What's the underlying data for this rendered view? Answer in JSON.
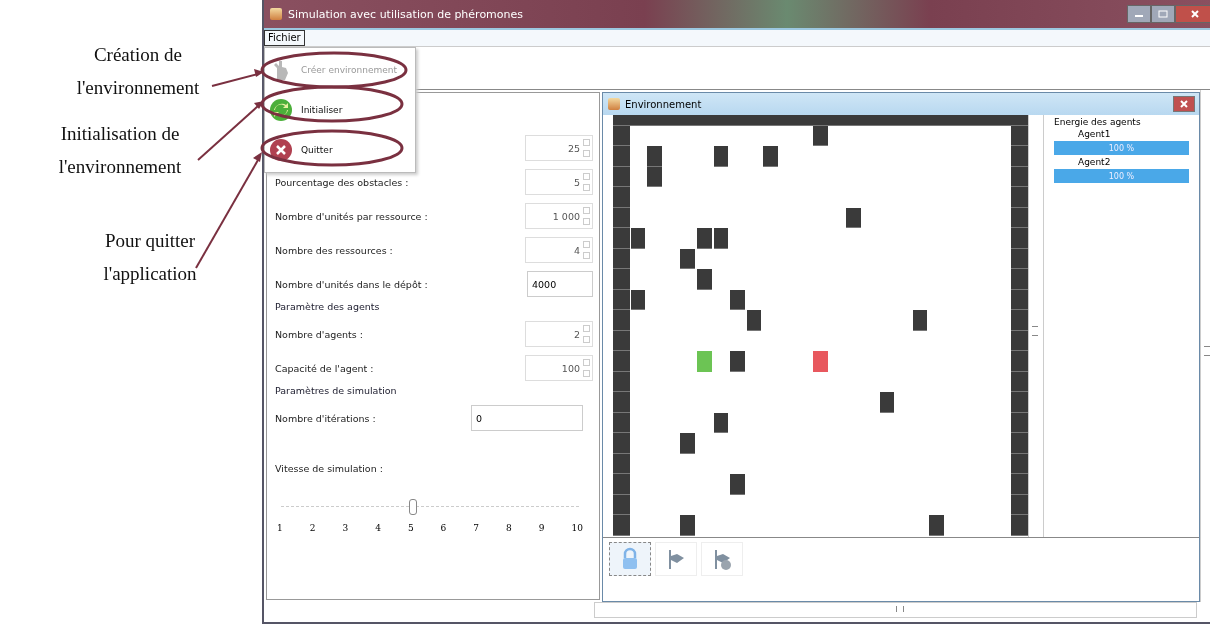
{
  "annotations": [
    {
      "text": "Création de l'environnement"
    },
    {
      "text": "Initialisation de l'environnement"
    },
    {
      "text": "Pour quitter l'application"
    }
  ],
  "window": {
    "title": "Simulation avec utilisation de phéromones"
  },
  "menu_bar": [
    {
      "label": "Fichier",
      "selected": true
    }
  ],
  "menu": {
    "items": [
      {
        "kind": "create",
        "label": "Créer environnement",
        "disabled": true
      },
      {
        "kind": "init",
        "label": "Initialiser",
        "disabled": false
      },
      {
        "kind": "quit",
        "label": "Quitter",
        "disabled": false
      }
    ]
  },
  "form": [
    {
      "kind": "spinner",
      "value": "25"
    },
    {
      "kind": "spinner",
      "label": "Pourcentage des obstacles :",
      "value": "5"
    },
    {
      "kind": "spinner",
      "label": "Nombre d'unités par ressource :",
      "value": "1 000"
    },
    {
      "kind": "spinner",
      "label": "Nombre des ressources :",
      "value": "4"
    },
    {
      "kind": "text",
      "label": "Nombre d'unités dans le dépôt :",
      "value": "4000",
      "wide": false
    },
    {
      "kind": "section",
      "label": "Paramètre des agents"
    },
    {
      "kind": "spinner",
      "label": "Nombre d'agents :",
      "value": "2"
    },
    {
      "kind": "spinner",
      "label": "Capacité de l'agent :",
      "value": "100"
    },
    {
      "kind": "section",
      "label": "Paramètres de simulation"
    },
    {
      "kind": "text",
      "label": "Nombre d'itérations :",
      "value": "0",
      "wide": true
    },
    {
      "kind": "label",
      "label": "Vitesse de simulation :"
    },
    {
      "kind": "slider",
      "level": 0.444,
      "ticks": [
        "1",
        "2",
        "3",
        "4",
        "5",
        "6",
        "7",
        "8",
        "9",
        "10"
      ]
    }
  ],
  "environment": {
    "title": "Environnement",
    "grid": [
      [
        {
          "kind": "wall"
        },
        {
          "kind": "wall"
        },
        {
          "kind": "wall"
        },
        {
          "kind": "wall"
        },
        {
          "kind": "wall"
        },
        {
          "kind": "wall"
        },
        {
          "kind": "wall"
        },
        {
          "kind": "wall"
        },
        {
          "kind": "wall"
        },
        {
          "kind": "wall"
        },
        {
          "kind": "wall"
        },
        {
          "kind": "wall"
        },
        {
          "kind": "wall"
        },
        {
          "kind": "wall"
        },
        {
          "kind": "wall"
        },
        {
          "kind": "wall"
        },
        {
          "kind": "wall"
        },
        {
          "kind": "wall"
        },
        {
          "kind": "wall"
        },
        {
          "kind": "wall"
        },
        {
          "kind": "wall"
        },
        {
          "kind": "wall"
        },
        {
          "kind": "wall"
        },
        {
          "kind": "wall"
        },
        {
          "kind": "wall"
        }
      ],
      [
        {
          "kind": "wall"
        },
        {
          "kind": "empty"
        },
        {
          "kind": "empty"
        },
        {
          "kind": "empty"
        },
        {
          "kind": "empty"
        },
        {
          "kind": "empty"
        },
        {
          "kind": "empty"
        },
        {
          "kind": "empty"
        },
        {
          "kind": "empty"
        },
        {
          "kind": "empty"
        },
        {
          "kind": "empty"
        },
        {
          "kind": "empty"
        },
        {
          "kind": "obstacle"
        },
        {
          "kind": "empty"
        },
        {
          "kind": "empty"
        },
        {
          "kind": "empty"
        },
        {
          "kind": "empty"
        },
        {
          "kind": "empty"
        },
        {
          "kind": "empty"
        },
        {
          "kind": "empty"
        },
        {
          "kind": "empty"
        },
        {
          "kind": "empty"
        },
        {
          "kind": "empty"
        },
        {
          "kind": "empty"
        },
        {
          "kind": "wall"
        }
      ],
      [
        {
          "kind": "wall"
        },
        {
          "kind": "empty"
        },
        {
          "kind": "obstacle"
        },
        {
          "kind": "empty"
        },
        {
          "kind": "empty"
        },
        {
          "kind": "empty"
        },
        {
          "kind": "obstacle"
        },
        {
          "kind": "empty"
        },
        {
          "kind": "empty"
        },
        {
          "kind": "obstacle"
        },
        {
          "kind": "empty"
        },
        {
          "kind": "empty"
        },
        {
          "kind": "empty"
        },
        {
          "kind": "empty"
        },
        {
          "kind": "empty"
        },
        {
          "kind": "empty"
        },
        {
          "kind": "empty"
        },
        {
          "kind": "empty"
        },
        {
          "kind": "empty"
        },
        {
          "kind": "empty"
        },
        {
          "kind": "empty"
        },
        {
          "kind": "empty"
        },
        {
          "kind": "empty"
        },
        {
          "kind": "empty"
        },
        {
          "kind": "wall"
        }
      ],
      [
        {
          "kind": "wall"
        },
        {
          "kind": "empty"
        },
        {
          "kind": "obstacle"
        },
        {
          "kind": "empty"
        },
        {
          "kind": "empty"
        },
        {
          "kind": "empty"
        },
        {
          "kind": "empty"
        },
        {
          "kind": "empty"
        },
        {
          "kind": "empty"
        },
        {
          "kind": "empty"
        },
        {
          "kind": "empty"
        },
        {
          "kind": "empty"
        },
        {
          "kind": "empty"
        },
        {
          "kind": "empty"
        },
        {
          "kind": "empty"
        },
        {
          "kind": "empty"
        },
        {
          "kind": "empty"
        },
        {
          "kind": "empty"
        },
        {
          "kind": "empty"
        },
        {
          "kind": "empty"
        },
        {
          "kind": "empty"
        },
        {
          "kind": "empty"
        },
        {
          "kind": "empty"
        },
        {
          "kind": "empty"
        },
        {
          "kind": "wall"
        }
      ],
      [
        {
          "kind": "wall"
        },
        {
          "kind": "empty"
        },
        {
          "kind": "empty"
        },
        {
          "kind": "empty"
        },
        {
          "kind": "empty"
        },
        {
          "kind": "empty"
        },
        {
          "kind": "empty"
        },
        {
          "kind": "empty"
        },
        {
          "kind": "empty"
        },
        {
          "kind": "empty"
        },
        {
          "kind": "empty"
        },
        {
          "kind": "empty"
        },
        {
          "kind": "empty"
        },
        {
          "kind": "empty"
        },
        {
          "kind": "empty"
        },
        {
          "kind": "empty"
        },
        {
          "kind": "empty"
        },
        {
          "kind": "empty"
        },
        {
          "kind": "empty"
        },
        {
          "kind": "empty"
        },
        {
          "kind": "empty"
        },
        {
          "kind": "empty"
        },
        {
          "kind": "empty"
        },
        {
          "kind": "empty"
        },
        {
          "kind": "wall"
        }
      ],
      [
        {
          "kind": "wall"
        },
        {
          "kind": "empty"
        },
        {
          "kind": "empty"
        },
        {
          "kind": "empty"
        },
        {
          "kind": "empty"
        },
        {
          "kind": "empty"
        },
        {
          "kind": "empty"
        },
        {
          "kind": "empty"
        },
        {
          "kind": "empty"
        },
        {
          "kind": "empty"
        },
        {
          "kind": "empty"
        },
        {
          "kind": "empty"
        },
        {
          "kind": "empty"
        },
        {
          "kind": "empty"
        },
        {
          "kind": "obstacle"
        },
        {
          "kind": "empty"
        },
        {
          "kind": "empty"
        },
        {
          "kind": "empty"
        },
        {
          "kind": "empty"
        },
        {
          "kind": "empty"
        },
        {
          "kind": "empty"
        },
        {
          "kind": "empty"
        },
        {
          "kind": "empty"
        },
        {
          "kind": "empty"
        },
        {
          "kind": "wall"
        }
      ],
      [
        {
          "kind": "wall"
        },
        {
          "kind": "obstacle"
        },
        {
          "kind": "empty"
        },
        {
          "kind": "empty"
        },
        {
          "kind": "empty"
        },
        {
          "kind": "obstacle"
        },
        {
          "kind": "obstacle"
        },
        {
          "kind": "empty"
        },
        {
          "kind": "empty"
        },
        {
          "kind": "empty"
        },
        {
          "kind": "empty"
        },
        {
          "kind": "empty"
        },
        {
          "kind": "empty"
        },
        {
          "kind": "empty"
        },
        {
          "kind": "empty"
        },
        {
          "kind": "empty"
        },
        {
          "kind": "empty"
        },
        {
          "kind": "empty"
        },
        {
          "kind": "empty"
        },
        {
          "kind": "empty"
        },
        {
          "kind": "empty"
        },
        {
          "kind": "empty"
        },
        {
          "kind": "empty"
        },
        {
          "kind": "empty"
        },
        {
          "kind": "wall"
        }
      ],
      [
        {
          "kind": "wall"
        },
        {
          "kind": "empty"
        },
        {
          "kind": "empty"
        },
        {
          "kind": "empty"
        },
        {
          "kind": "obstacle"
        },
        {
          "kind": "empty"
        },
        {
          "kind": "empty"
        },
        {
          "kind": "empty"
        },
        {
          "kind": "empty"
        },
        {
          "kind": "empty"
        },
        {
          "kind": "empty"
        },
        {
          "kind": "empty"
        },
        {
          "kind": "empty"
        },
        {
          "kind": "empty"
        },
        {
          "kind": "empty"
        },
        {
          "kind": "empty"
        },
        {
          "kind": "empty"
        },
        {
          "kind": "empty"
        },
        {
          "kind": "empty"
        },
        {
          "kind": "empty"
        },
        {
          "kind": "empty"
        },
        {
          "kind": "empty"
        },
        {
          "kind": "empty"
        },
        {
          "kind": "empty"
        },
        {
          "kind": "wall"
        }
      ],
      [
        {
          "kind": "wall"
        },
        {
          "kind": "empty"
        },
        {
          "kind": "empty"
        },
        {
          "kind": "empty"
        },
        {
          "kind": "empty"
        },
        {
          "kind": "obstacle"
        },
        {
          "kind": "empty"
        },
        {
          "kind": "empty"
        },
        {
          "kind": "empty"
        },
        {
          "kind": "empty"
        },
        {
          "kind": "empty"
        },
        {
          "kind": "empty"
        },
        {
          "kind": "empty"
        },
        {
          "kind": "empty"
        },
        {
          "kind": "empty"
        },
        {
          "kind": "empty"
        },
        {
          "kind": "empty"
        },
        {
          "kind": "empty"
        },
        {
          "kind": "empty"
        },
        {
          "kind": "empty"
        },
        {
          "kind": "empty"
        },
        {
          "kind": "empty"
        },
        {
          "kind": "empty"
        },
        {
          "kind": "empty"
        },
        {
          "kind": "wall"
        }
      ],
      [
        {
          "kind": "wall"
        },
        {
          "kind": "obstacle"
        },
        {
          "kind": "empty"
        },
        {
          "kind": "empty"
        },
        {
          "kind": "empty"
        },
        {
          "kind": "empty"
        },
        {
          "kind": "empty"
        },
        {
          "kind": "obstacle"
        },
        {
          "kind": "empty"
        },
        {
          "kind": "empty"
        },
        {
          "kind": "empty"
        },
        {
          "kind": "empty"
        },
        {
          "kind": "empty"
        },
        {
          "kind": "empty"
        },
        {
          "kind": "empty"
        },
        {
          "kind": "empty"
        },
        {
          "kind": "empty"
        },
        {
          "kind": "empty"
        },
        {
          "kind": "empty"
        },
        {
          "kind": "empty"
        },
        {
          "kind": "empty"
        },
        {
          "kind": "empty"
        },
        {
          "kind": "empty"
        },
        {
          "kind": "empty"
        },
        {
          "kind": "wall"
        }
      ],
      [
        {
          "kind": "wall"
        },
        {
          "kind": "empty"
        },
        {
          "kind": "empty"
        },
        {
          "kind": "empty"
        },
        {
          "kind": "empty"
        },
        {
          "kind": "empty"
        },
        {
          "kind": "empty"
        },
        {
          "kind": "empty"
        },
        {
          "kind": "obstacle"
        },
        {
          "kind": "empty"
        },
        {
          "kind": "empty"
        },
        {
          "kind": "empty"
        },
        {
          "kind": "empty"
        },
        {
          "kind": "empty"
        },
        {
          "kind": "empty"
        },
        {
          "kind": "empty"
        },
        {
          "kind": "empty"
        },
        {
          "kind": "empty"
        },
        {
          "kind": "obstacle"
        },
        {
          "kind": "empty"
        },
        {
          "kind": "empty"
        },
        {
          "kind": "empty"
        },
        {
          "kind": "empty"
        },
        {
          "kind": "empty"
        },
        {
          "kind": "wall"
        }
      ],
      [
        {
          "kind": "wall"
        },
        {
          "kind": "empty"
        },
        {
          "kind": "empty"
        },
        {
          "kind": "empty"
        },
        {
          "kind": "empty"
        },
        {
          "kind": "empty"
        },
        {
          "kind": "empty"
        },
        {
          "kind": "empty"
        },
        {
          "kind": "empty"
        },
        {
          "kind": "empty"
        },
        {
          "kind": "empty"
        },
        {
          "kind": "empty"
        },
        {
          "kind": "empty"
        },
        {
          "kind": "empty"
        },
        {
          "kind": "empty"
        },
        {
          "kind": "empty"
        },
        {
          "kind": "empty"
        },
        {
          "kind": "empty"
        },
        {
          "kind": "empty"
        },
        {
          "kind": "empty"
        },
        {
          "kind": "empty"
        },
        {
          "kind": "empty"
        },
        {
          "kind": "empty"
        },
        {
          "kind": "empty"
        },
        {
          "kind": "wall"
        }
      ],
      [
        {
          "kind": "wall"
        },
        {
          "kind": "empty"
        },
        {
          "kind": "empty"
        },
        {
          "kind": "empty"
        },
        {
          "kind": "empty"
        },
        {
          "kind": "agent",
          "color": "#6cc454"
        },
        {
          "kind": "empty"
        },
        {
          "kind": "obstacle"
        },
        {
          "kind": "empty"
        },
        {
          "kind": "empty"
        },
        {
          "kind": "empty"
        },
        {
          "kind": "empty"
        },
        {
          "kind": "agent",
          "color": "#e8585e"
        },
        {
          "kind": "empty"
        },
        {
          "kind": "empty"
        },
        {
          "kind": "empty"
        },
        {
          "kind": "empty"
        },
        {
          "kind": "empty"
        },
        {
          "kind": "empty"
        },
        {
          "kind": "empty"
        },
        {
          "kind": "empty"
        },
        {
          "kind": "empty"
        },
        {
          "kind": "empty"
        },
        {
          "kind": "empty"
        },
        {
          "kind": "wall"
        }
      ],
      [
        {
          "kind": "wall"
        },
        {
          "kind": "empty"
        },
        {
          "kind": "empty"
        },
        {
          "kind": "empty"
        },
        {
          "kind": "empty"
        },
        {
          "kind": "empty"
        },
        {
          "kind": "empty"
        },
        {
          "kind": "empty"
        },
        {
          "kind": "empty"
        },
        {
          "kind": "empty"
        },
        {
          "kind": "empty"
        },
        {
          "kind": "empty"
        },
        {
          "kind": "empty"
        },
        {
          "kind": "empty"
        },
        {
          "kind": "empty"
        },
        {
          "kind": "empty"
        },
        {
          "kind": "empty"
        },
        {
          "kind": "empty"
        },
        {
          "kind": "empty"
        },
        {
          "kind": "empty"
        },
        {
          "kind": "empty"
        },
        {
          "kind": "empty"
        },
        {
          "kind": "empty"
        },
        {
          "kind": "empty"
        },
        {
          "kind": "wall"
        }
      ],
      [
        {
          "kind": "wall"
        },
        {
          "kind": "empty"
        },
        {
          "kind": "empty"
        },
        {
          "kind": "empty"
        },
        {
          "kind": "empty"
        },
        {
          "kind": "empty"
        },
        {
          "kind": "empty"
        },
        {
          "kind": "empty"
        },
        {
          "kind": "empty"
        },
        {
          "kind": "empty"
        },
        {
          "kind": "empty"
        },
        {
          "kind": "empty"
        },
        {
          "kind": "empty"
        },
        {
          "kind": "empty"
        },
        {
          "kind": "empty"
        },
        {
          "kind": "empty"
        },
        {
          "kind": "obstacle"
        },
        {
          "kind": "empty"
        },
        {
          "kind": "empty"
        },
        {
          "kind": "empty"
        },
        {
          "kind": "empty"
        },
        {
          "kind": "empty"
        },
        {
          "kind": "empty"
        },
        {
          "kind": "empty"
        },
        {
          "kind": "wall"
        }
      ],
      [
        {
          "kind": "wall"
        },
        {
          "kind": "empty"
        },
        {
          "kind": "empty"
        },
        {
          "kind": "empty"
        },
        {
          "kind": "empty"
        },
        {
          "kind": "empty"
        },
        {
          "kind": "obstacle"
        },
        {
          "kind": "empty"
        },
        {
          "kind": "empty"
        },
        {
          "kind": "empty"
        },
        {
          "kind": "empty"
        },
        {
          "kind": "empty"
        },
        {
          "kind": "empty"
        },
        {
          "kind": "empty"
        },
        {
          "kind": "empty"
        },
        {
          "kind": "empty"
        },
        {
          "kind": "empty"
        },
        {
          "kind": "empty"
        },
        {
          "kind": "empty"
        },
        {
          "kind": "empty"
        },
        {
          "kind": "empty"
        },
        {
          "kind": "empty"
        },
        {
          "kind": "empty"
        },
        {
          "kind": "empty"
        },
        {
          "kind": "wall"
        }
      ],
      [
        {
          "kind": "wall"
        },
        {
          "kind": "empty"
        },
        {
          "kind": "empty"
        },
        {
          "kind": "empty"
        },
        {
          "kind": "obstacle"
        },
        {
          "kind": "empty"
        },
        {
          "kind": "empty"
        },
        {
          "kind": "empty"
        },
        {
          "kind": "empty"
        },
        {
          "kind": "empty"
        },
        {
          "kind": "empty"
        },
        {
          "kind": "empty"
        },
        {
          "kind": "empty"
        },
        {
          "kind": "empty"
        },
        {
          "kind": "empty"
        },
        {
          "kind": "empty"
        },
        {
          "kind": "empty"
        },
        {
          "kind": "empty"
        },
        {
          "kind": "empty"
        },
        {
          "kind": "empty"
        },
        {
          "kind": "empty"
        },
        {
          "kind": "empty"
        },
        {
          "kind": "empty"
        },
        {
          "kind": "empty"
        },
        {
          "kind": "wall"
        }
      ],
      [
        {
          "kind": "wall"
        },
        {
          "kind": "empty"
        },
        {
          "kind": "empty"
        },
        {
          "kind": "empty"
        },
        {
          "kind": "empty"
        },
        {
          "kind": "empty"
        },
        {
          "kind": "empty"
        },
        {
          "kind": "empty"
        },
        {
          "kind": "empty"
        },
        {
          "kind": "empty"
        },
        {
          "kind": "empty"
        },
        {
          "kind": "empty"
        },
        {
          "kind": "empty"
        },
        {
          "kind": "empty"
        },
        {
          "kind": "empty"
        },
        {
          "kind": "empty"
        },
        {
          "kind": "empty"
        },
        {
          "kind": "empty"
        },
        {
          "kind": "empty"
        },
        {
          "kind": "empty"
        },
        {
          "kind": "empty"
        },
        {
          "kind": "empty"
        },
        {
          "kind": "empty"
        },
        {
          "kind": "empty"
        },
        {
          "kind": "wall"
        }
      ],
      [
        {
          "kind": "wall"
        },
        {
          "kind": "empty"
        },
        {
          "kind": "empty"
        },
        {
          "kind": "empty"
        },
        {
          "kind": "empty"
        },
        {
          "kind": "empty"
        },
        {
          "kind": "empty"
        },
        {
          "kind": "obstacle"
        },
        {
          "kind": "empty"
        },
        {
          "kind": "empty"
        },
        {
          "kind": "empty"
        },
        {
          "kind": "empty"
        },
        {
          "kind": "empty"
        },
        {
          "kind": "empty"
        },
        {
          "kind": "empty"
        },
        {
          "kind": "empty"
        },
        {
          "kind": "empty"
        },
        {
          "kind": "empty"
        },
        {
          "kind": "empty"
        },
        {
          "kind": "empty"
        },
        {
          "kind": "empty"
        },
        {
          "kind": "empty"
        },
        {
          "kind": "empty"
        },
        {
          "kind": "empty"
        },
        {
          "kind": "wall"
        }
      ],
      [
        {
          "kind": "wall"
        },
        {
          "kind": "empty"
        },
        {
          "kind": "empty"
        },
        {
          "kind": "empty"
        },
        {
          "kind": "empty"
        },
        {
          "kind": "empty"
        },
        {
          "kind": "empty"
        },
        {
          "kind": "empty"
        },
        {
          "kind": "empty"
        },
        {
          "kind": "empty"
        },
        {
          "kind": "empty"
        },
        {
          "kind": "empty"
        },
        {
          "kind": "empty"
        },
        {
          "kind": "empty"
        },
        {
          "kind": "empty"
        },
        {
          "kind": "empty"
        },
        {
          "kind": "empty"
        },
        {
          "kind": "empty"
        },
        {
          "kind": "empty"
        },
        {
          "kind": "empty"
        },
        {
          "kind": "empty"
        },
        {
          "kind": "empty"
        },
        {
          "kind": "empty"
        },
        {
          "kind": "empty"
        },
        {
          "kind": "wall"
        }
      ],
      [
        {
          "kind": "wall"
        },
        {
          "kind": "empty"
        },
        {
          "kind": "empty"
        },
        {
          "kind": "empty"
        },
        {
          "kind": "obstacle"
        },
        {
          "kind": "empty"
        },
        {
          "kind": "empty"
        },
        {
          "kind": "empty"
        },
        {
          "kind": "empty"
        },
        {
          "kind": "empty"
        },
        {
          "kind": "empty"
        },
        {
          "kind": "empty"
        },
        {
          "kind": "empty"
        },
        {
          "kind": "empty"
        },
        {
          "kind": "empty"
        },
        {
          "kind": "empty"
        },
        {
          "kind": "empty"
        },
        {
          "kind": "empty"
        },
        {
          "kind": "empty"
        },
        {
          "kind": "obstacle"
        },
        {
          "kind": "empty"
        },
        {
          "kind": "empty"
        },
        {
          "kind": "empty"
        },
        {
          "kind": "empty"
        },
        {
          "kind": "wall"
        }
      ]
    ],
    "energy": {
      "title": "Energie des agents",
      "agents": [
        {
          "name": "Agent1",
          "level": 1,
          "reading": "100 %"
        },
        {
          "name": "Agent2",
          "level": 1,
          "reading": "100 %"
        }
      ]
    },
    "tools": [
      {
        "kind": "lock",
        "selected": true
      },
      {
        "kind": "flag",
        "selected": false
      },
      {
        "kind": "flag_coin",
        "selected": false
      }
    ]
  }
}
